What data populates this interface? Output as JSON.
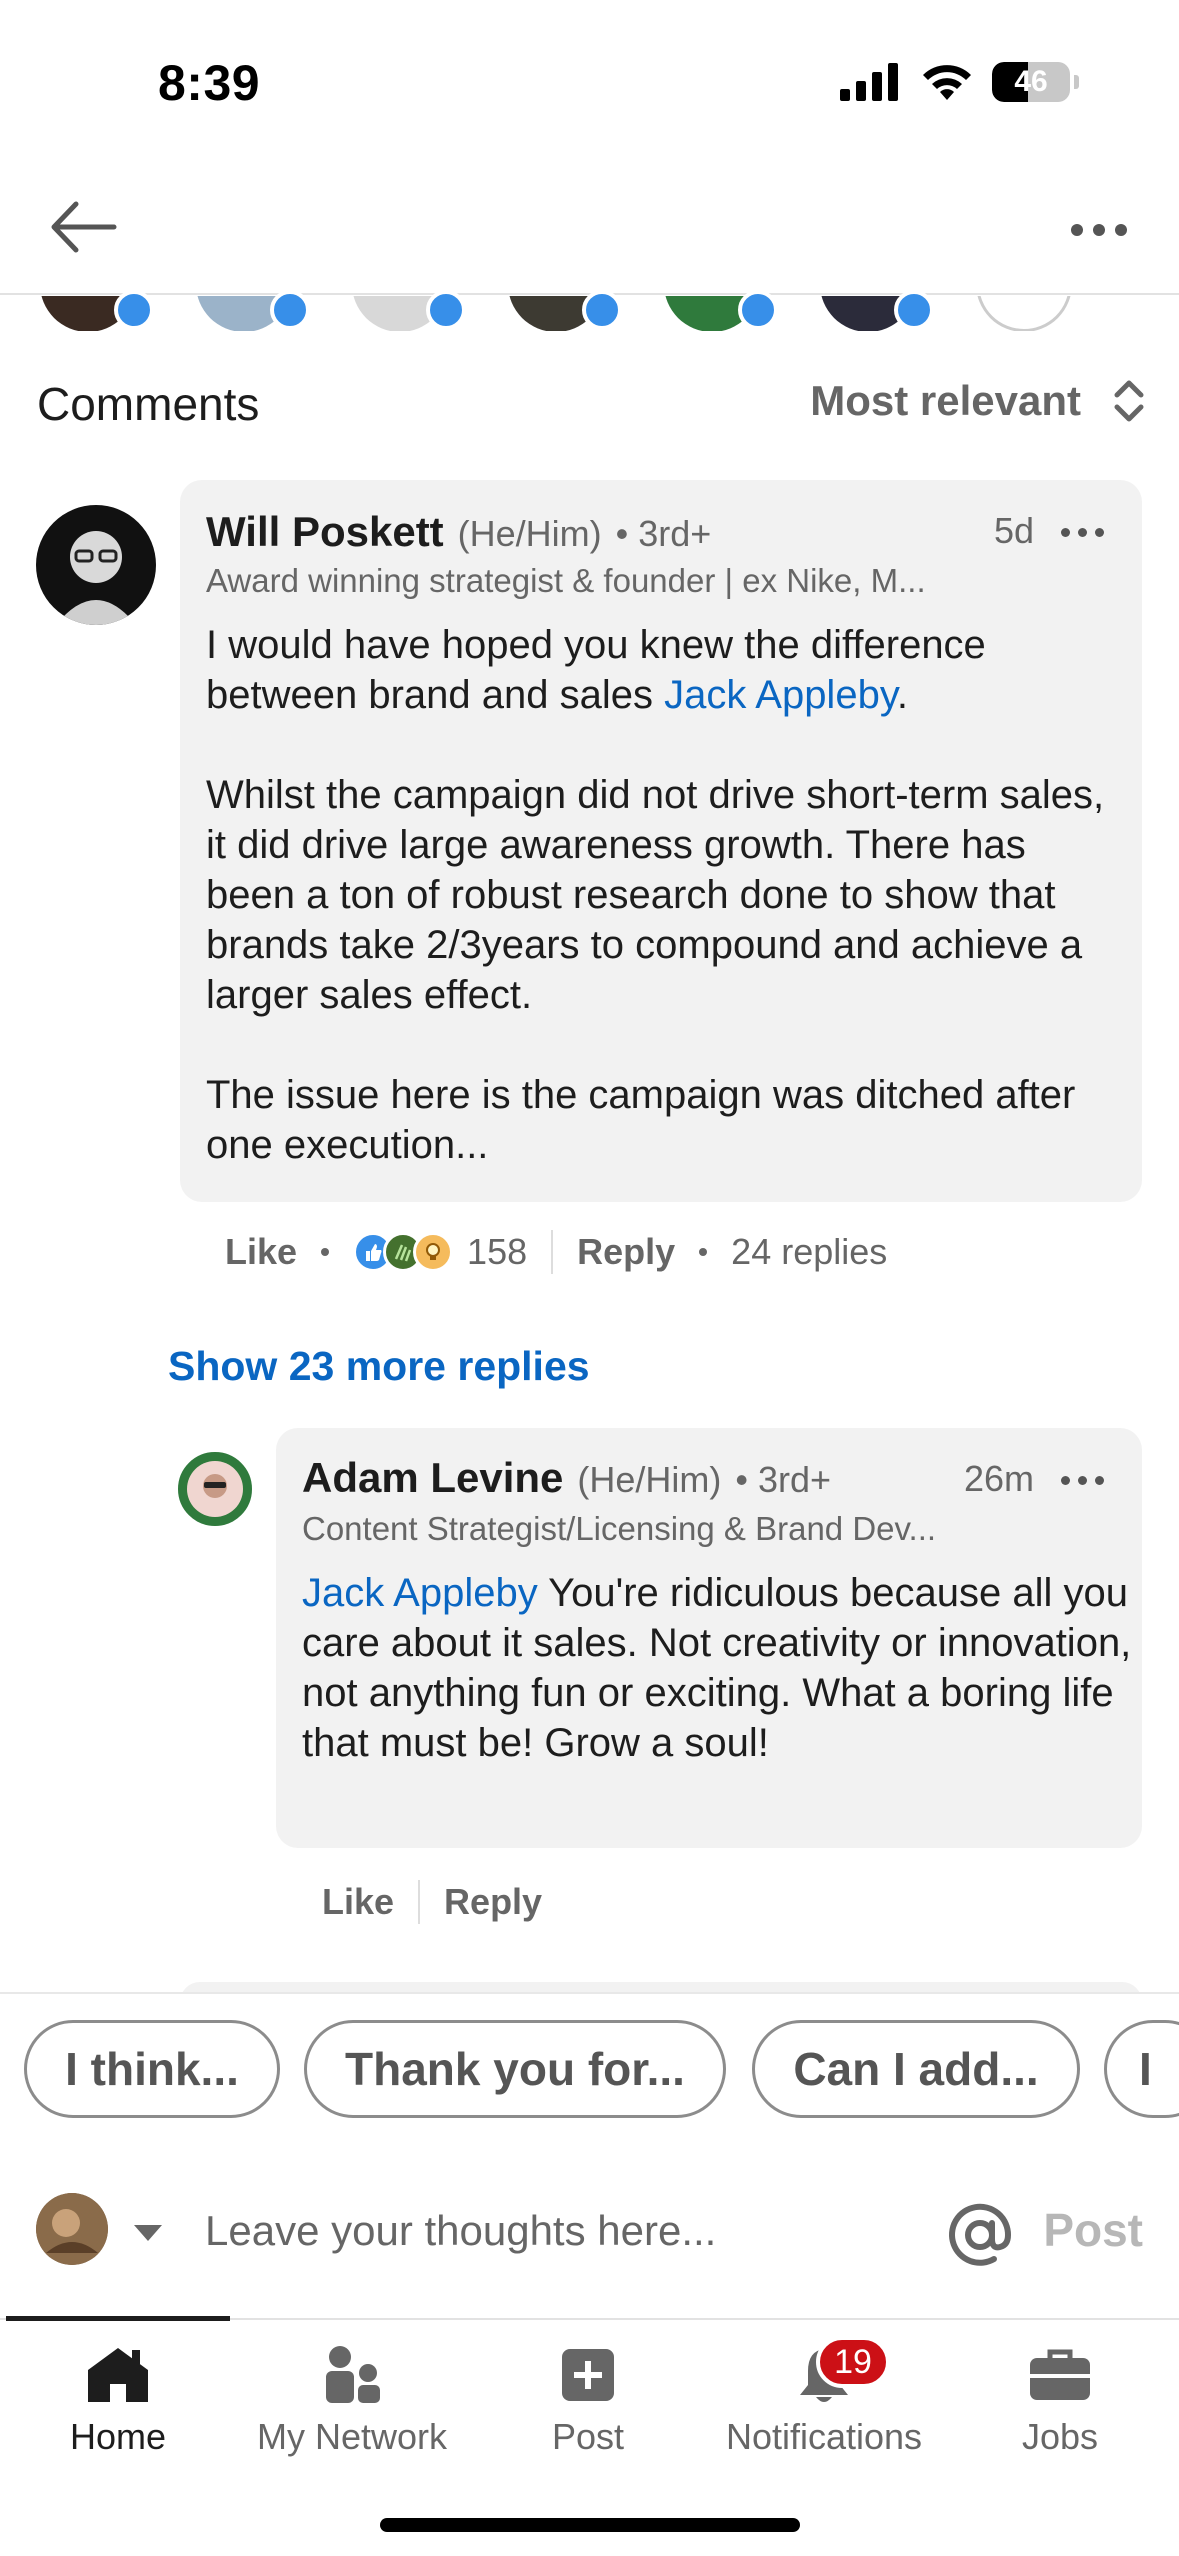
{
  "status_bar": {
    "time": "8:39",
    "battery": "46",
    "battery_level": 0.46
  },
  "comments_header": {
    "title": "Comments",
    "sort_label": "Most relevant"
  },
  "comment": {
    "author": "Will Poskett",
    "pronouns": "(He/Him)",
    "degree": "• 3rd+",
    "time": "5d",
    "headline": "Award winning strategist & founder | ex Nike, M...",
    "p1_pre": "I  would have hoped you knew the difference between brand and sales ",
    "mention": "Jack Appleby",
    "p1_post": ".",
    "p2": "Whilst the campaign did not drive short-term sales, it did drive large awareness growth. There has been a ton of robust research done to show that brands take 2/3years to compound and achieve a larger sales effect.",
    "p3": "The issue here is the campaign was ditched after one execution...",
    "like_label": "Like",
    "reaction_count": "158",
    "reply_label": "Reply",
    "replies_count": "24 replies"
  },
  "show_more": "Show 23 more replies",
  "reply": {
    "author": "Adam Levine",
    "pronouns": "(He/Him)",
    "degree": "• 3rd+",
    "time": "26m",
    "headline": "Content Strategist/Licensing & Brand Dev...",
    "mention": "Jack Appleby",
    "text": " You're ridiculous because all you care about it sales. Not creativity or innovation, not anything fun or exciting. What a boring life that must be! Grow a soul!",
    "like_label": "Like",
    "reply_label": "Reply"
  },
  "suggestions": [
    "I think...",
    "Thank you for...",
    "Can I add...",
    "I"
  ],
  "composer": {
    "placeholder": "Leave your thoughts here...",
    "post_label": "Post"
  },
  "bottom_nav": [
    {
      "label": "Home",
      "icon": "home-icon"
    },
    {
      "label": "My Network",
      "icon": "network-icon"
    },
    {
      "label": "Post",
      "icon": "post-icon"
    },
    {
      "label": "Notifications",
      "icon": "bell-icon",
      "badge": "19"
    },
    {
      "label": "Jobs",
      "icon": "briefcase-icon"
    }
  ],
  "colors": {
    "link": "#0a66c2",
    "badge": "#cc1016",
    "bubble": "#f2f2f2"
  }
}
